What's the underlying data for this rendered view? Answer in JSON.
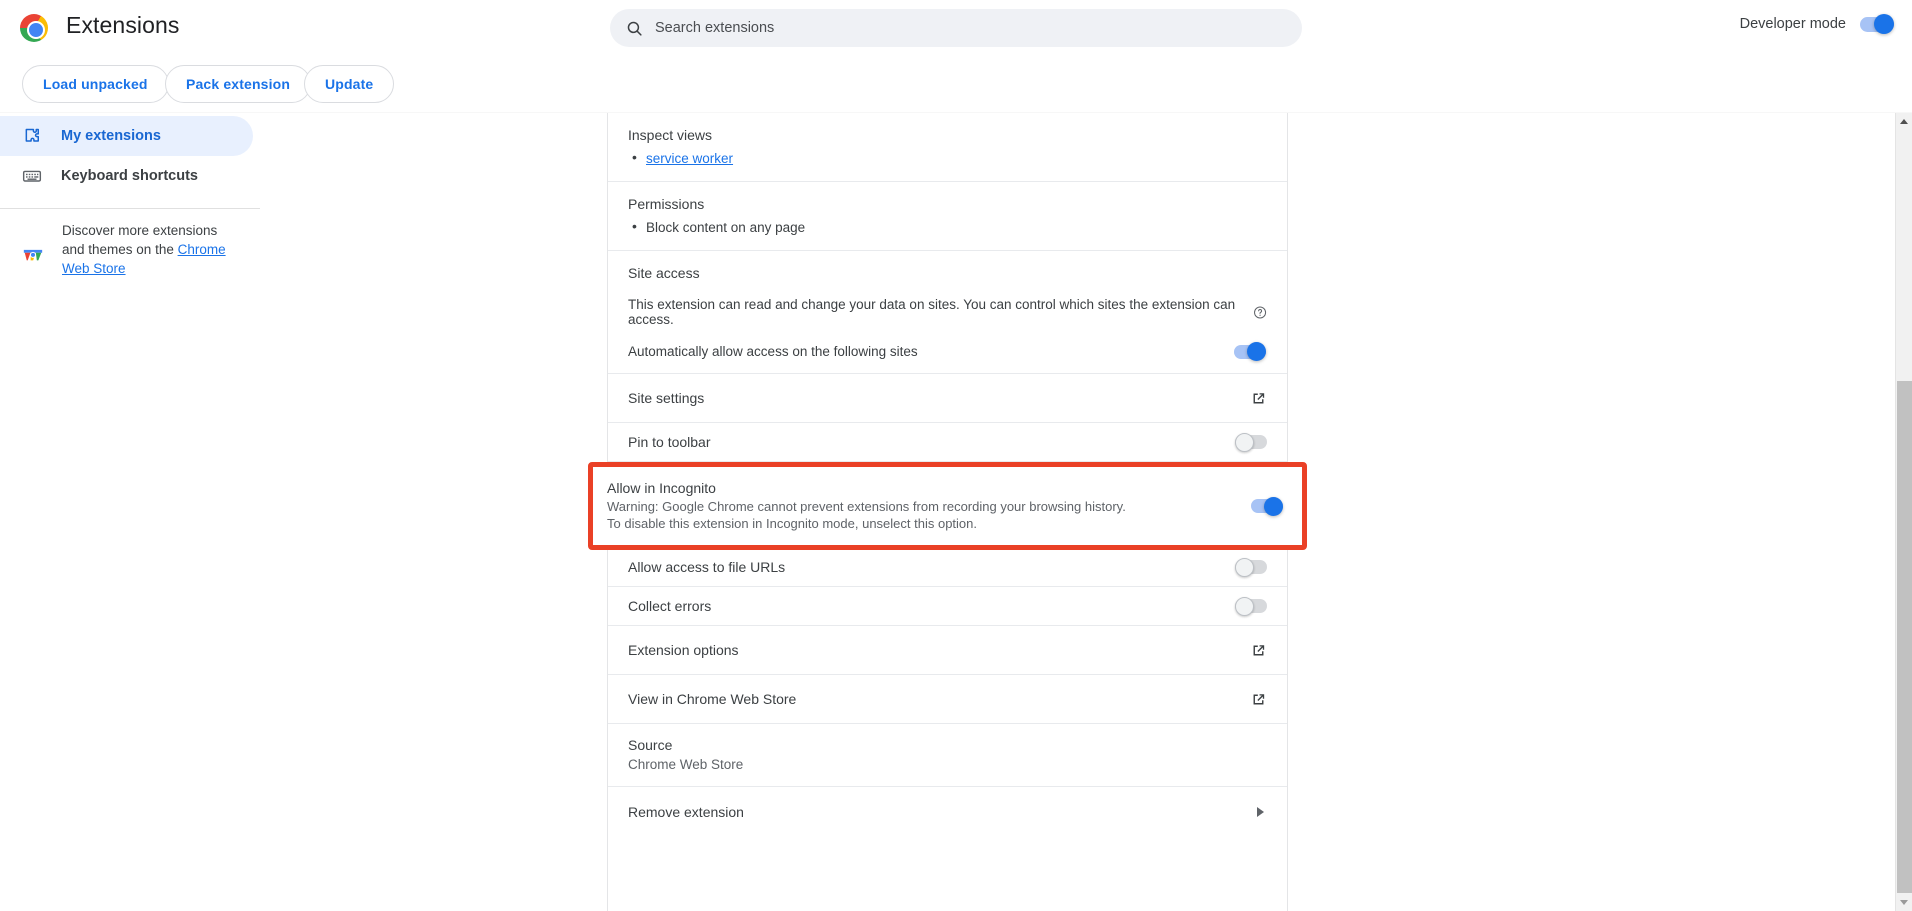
{
  "header": {
    "title": "Extensions",
    "logo_icon": "chrome-logo",
    "search": {
      "icon": "search-icon",
      "placeholder": "Search extensions",
      "value": ""
    },
    "developer_mode": {
      "label": "Developer mode",
      "state": "on"
    },
    "buttons": [
      {
        "label": "Load unpacked"
      },
      {
        "label": "Pack extension"
      },
      {
        "label": "Update"
      }
    ]
  },
  "sidebar": {
    "items": [
      {
        "label": "My extensions",
        "icon": "puzzle-piece-icon",
        "selected": true
      },
      {
        "label": "Keyboard shortcuts",
        "icon": "keyboard-icon",
        "selected": false
      }
    ],
    "discover": {
      "icon": "chrome-web-store-icon",
      "text_before": "Discover more extensions and themes on the ",
      "link_text": "Chrome Web Store"
    }
  },
  "detail": {
    "inspect_views": {
      "title": "Inspect views",
      "items": [
        "service worker"
      ]
    },
    "permissions": {
      "title": "Permissions",
      "items": [
        "Block content on any page"
      ]
    },
    "site_access": {
      "title": "Site access",
      "description": "This extension can read and change your data on sites. You can control which sites the extension can access.",
      "help_icon": "help-circle-icon",
      "auto_allow_label": "Automatically allow access on the following sites",
      "auto_allow_state": "on"
    },
    "rows": {
      "site_settings": {
        "label": "Site settings",
        "icon": "open-in-new-icon"
      },
      "pin_to_toolbar": {
        "label": "Pin to toolbar",
        "state": "off"
      },
      "allow_incognito": {
        "label": "Allow in Incognito",
        "warning": "Warning: Google Chrome cannot prevent extensions from recording your browsing history. To disable this extension in Incognito mode, unselect this option.",
        "state": "on",
        "highlight_color": "#ea4026"
      },
      "file_urls": {
        "label": "Allow access to file URLs",
        "state": "off"
      },
      "collect_errors": {
        "label": "Collect errors",
        "state": "off"
      },
      "extension_options": {
        "label": "Extension options",
        "icon": "open-in-new-icon"
      },
      "web_store": {
        "label": "View in Chrome Web Store",
        "icon": "open-in-new-icon"
      },
      "source": {
        "title": "Source",
        "value": "Chrome Web Store"
      },
      "remove_extension": {
        "label": "Remove extension",
        "icon": "chevron-right-icon"
      }
    }
  },
  "scrollbar": {
    "up_icon": "scroll-up-arrow-icon",
    "down_icon": "scroll-down-arrow-icon"
  },
  "colors": {
    "accent": "#1a73e8",
    "highlight": "#ea4026",
    "selected_nav_bg": "#e8f0fe",
    "toggle_off": "#d7d9dc"
  }
}
